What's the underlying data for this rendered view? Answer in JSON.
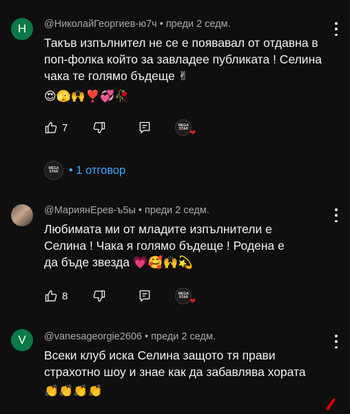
{
  "comments": [
    {
      "avatar_letter": "Н",
      "author": "@НиколайГеоргиев-ю7ч",
      "time": "преди 2 седм.",
      "text": "Такъв изпълнител не се е появавал от отдавна в поп-фолка който за завладее публиката ! Селина чака те голямо бъдеще ✌",
      "emoji_line": "😍🫣🙌❣️💞🥀",
      "likes": "7"
    },
    {
      "avatar_letter": "",
      "author": "@МариянЕрев-ъ5ы",
      "time": "преди 2 седм.",
      "text": "Любимата ми от младите изпълнители е Селина ! Чака я голямо бъдеще ! Родена е да бъде звезда 💗🥰🙌💫",
      "emoji_line": "",
      "likes": "8"
    },
    {
      "avatar_letter": "V",
      "author": "@vanesageorgie2606",
      "time": "преди 2 седм.",
      "text": "Всеки клуб иска Селина защото тя прави страхотно шоу и знае как да забавлява хората",
      "emoji_line": "👏👏👏👏",
      "likes": ""
    }
  ],
  "replies": {
    "label": "1 отговор",
    "bullet": "•"
  },
  "creator_badge": {
    "line1": "MEGA",
    "line2": "STAR"
  },
  "separator": "•",
  "colors": {
    "background": "#0f0f0f",
    "link": "#3ea6ff",
    "heart": "#e0161c",
    "avatar_green": "#0b7a47"
  },
  "icons": [
    "thumbs-up-icon",
    "thumbs-down-icon",
    "reply-icon",
    "more-vert-icon",
    "creator-heart-icon"
  ]
}
